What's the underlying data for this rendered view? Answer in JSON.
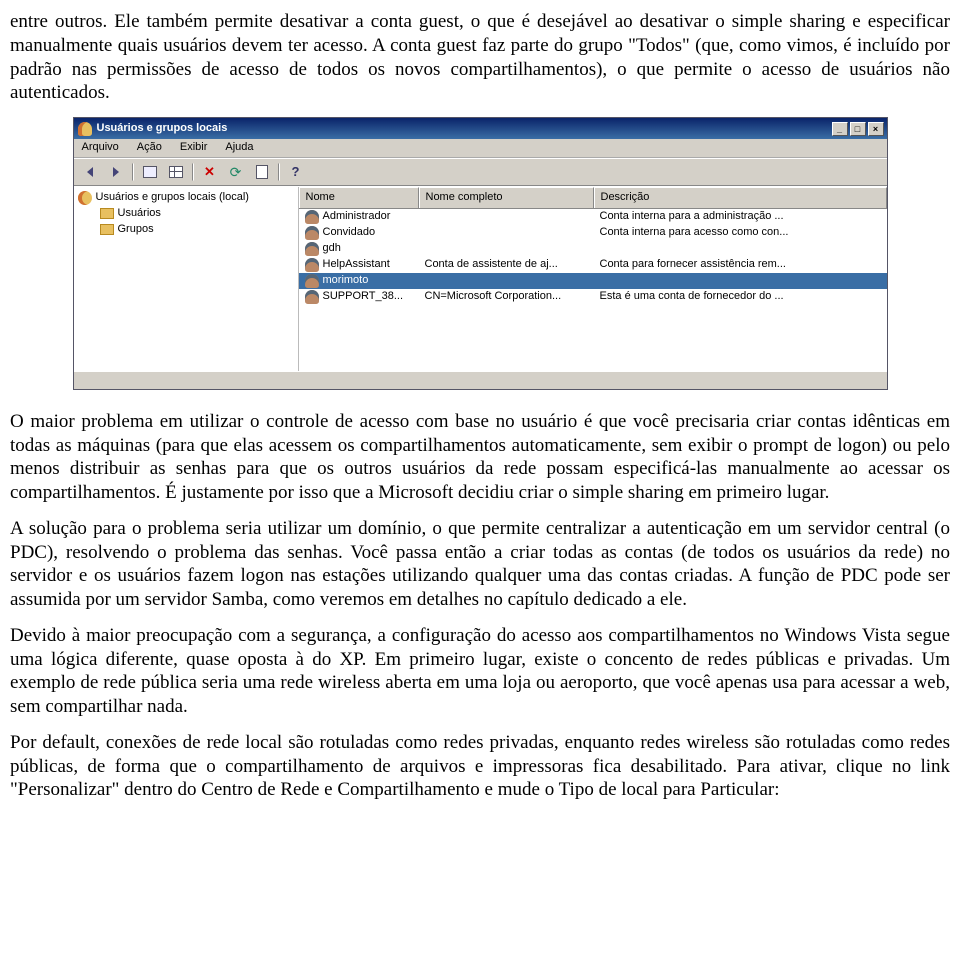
{
  "paragraphs": {
    "p1": "entre outros. Ele também permite desativar a conta guest, o que é desejável ao desativar o simple sharing e especificar manualmente quais usuários devem ter acesso. A conta guest faz parte do grupo \"Todos\" (que, como vimos, é incluído por padrão nas permissões de acesso de todos os novos compartilhamentos), o que permite o acesso de usuários não autenticados.",
    "p2": "O maior problema em utilizar o controle de acesso com base no usuário é que você precisaria criar contas idênticas em todas as máquinas (para que elas acessem os compartilhamentos automaticamente, sem exibir o prompt de logon) ou pelo menos distribuir as senhas para que os outros usuários da rede possam especificá-las manualmente ao acessar os compartilhamentos. É justamente por isso que a Microsoft decidiu criar o simple sharing em primeiro lugar.",
    "p3": "A solução para o problema seria utilizar um domínio, o que permite centralizar a autenticação em um servidor central (o PDC), resolvendo o problema das senhas. Você passa então a criar todas as contas (de todos os usuários da rede) no servidor e os usuários fazem logon nas estações utilizando qualquer uma das contas criadas. A função de PDC pode ser assumida por um servidor Samba, como veremos em detalhes no capítulo dedicado a ele.",
    "p4": "Devido à maior preocupação com a segurança, a configuração do acesso aos compartilhamentos no Windows Vista segue uma lógica diferente, quase oposta à do XP. Em primeiro lugar, existe o concento de redes públicas e privadas. Um exemplo de rede pública seria uma rede wireless aberta em uma loja ou aeroporto, que você apenas usa para acessar a web, sem compartilhar nada.",
    "p5": "Por default, conexões de rede local são rotuladas como redes privadas, enquanto redes wireless são rotuladas como redes públicas, de forma que o compartilhamento de arquivos e impressoras fica desabilitado. Para ativar, clique no link \"Personalizar\" dentro do Centro de Rede e Compartilhamento e mude o Tipo de local para Particular:"
  },
  "win": {
    "title": "Usuários e grupos locais",
    "btn_min": "_",
    "btn_max": "□",
    "btn_close": "×",
    "menus": [
      "Arquivo",
      "Ação",
      "Exibir",
      "Ajuda"
    ],
    "tree_root": "Usuários e grupos locais (local)",
    "tree_children": [
      "Usuários",
      "Grupos"
    ],
    "columns": [
      "Nome",
      "Nome completo",
      "Descrição"
    ],
    "rows": [
      {
        "name": "Administrador",
        "full": "",
        "desc": "Conta interna para a administração ...",
        "selected": false
      },
      {
        "name": "Convidado",
        "full": "",
        "desc": "Conta interna para acesso como con...",
        "selected": false
      },
      {
        "name": "gdh",
        "full": "",
        "desc": "",
        "selected": false
      },
      {
        "name": "HelpAssistant",
        "full": "Conta de assistente de aj...",
        "desc": "Conta para fornecer assistência rem...",
        "selected": false
      },
      {
        "name": "morimoto",
        "full": "",
        "desc": "",
        "selected": true
      },
      {
        "name": "SUPPORT_38...",
        "full": "CN=Microsoft Corporation...",
        "desc": "Esta é uma conta de fornecedor do ...",
        "selected": false
      }
    ]
  }
}
